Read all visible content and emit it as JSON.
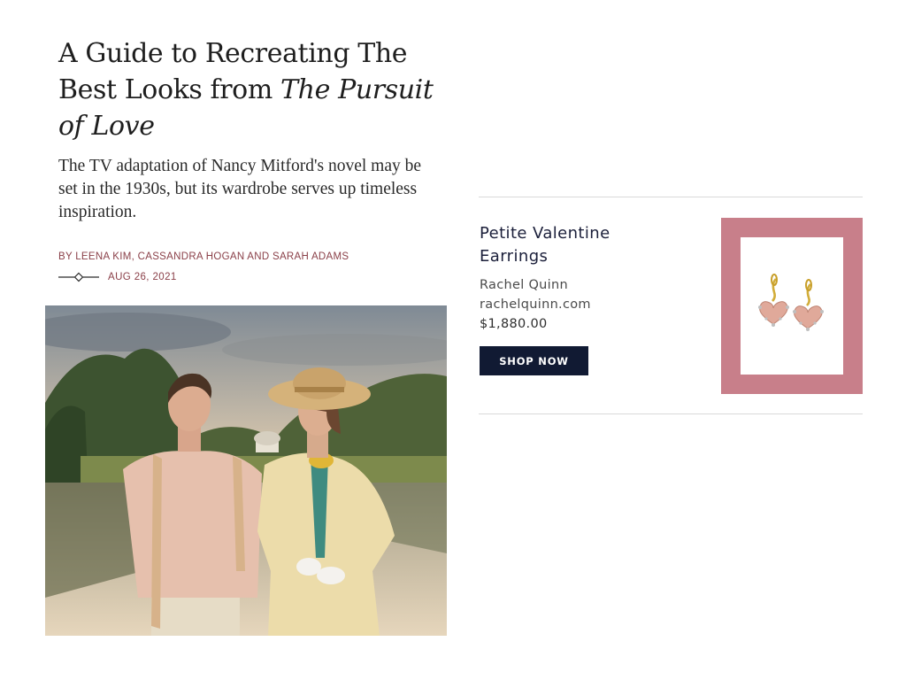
{
  "article": {
    "headline_part1": "A Guide to Recreating The Best Looks from ",
    "headline_italic": "The Pursuit of Love",
    "dek": "The TV adaptation of Nancy Mitford's novel may be set in the 1930s, but its wardrobe serves up timeless inspiration.",
    "byline": "BY LEENA KIM, CASSANDRA HOGAN AND SARAH ADAMS",
    "date": "AUG 26, 2021"
  },
  "product": {
    "name": "Petite Valentine Earrings",
    "brand": "Rachel Quinn",
    "site": "rachelquinn.com",
    "price": "$1,880.00",
    "cta": "SHOP NOW",
    "frame_color": "#c87f8a",
    "button_color": "#111a33"
  },
  "colors": {
    "byline": "#8a3f48",
    "rule": "#d9d9d9"
  },
  "icons": {
    "date_ornament": "line-diamond-line"
  }
}
